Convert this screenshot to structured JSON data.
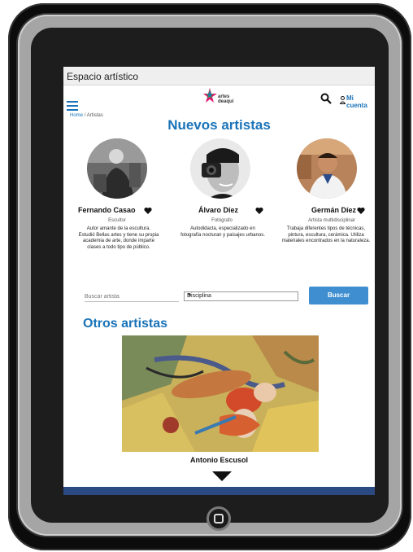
{
  "window": {
    "title": "Espacio artístico"
  },
  "header": {
    "logo_text": "artes deaquí",
    "account_label": "Mi cuenta"
  },
  "breadcrumb": {
    "home": "Home",
    "separator": "/",
    "current": "Artistas"
  },
  "page_title": "Nuevos artistas",
  "artists": [
    {
      "name": "Fernando Casao",
      "role": "Escultor",
      "description": "Autor amante de la escultura. Estudió Bellas artes y tiene su propia academia de arte, donde imparte clases a todo tipo de público."
    },
    {
      "name": "Álvaro Díez",
      "role": "Fotógrafo",
      "description": "Autodidacta, especializado en fotografía nocturan y paisajes urbanos."
    },
    {
      "name": "Germán Díez",
      "role": "Artista multidisciplinar",
      "description": "Trabaja diferentes tipos de técnicas, pintura, escultura, cerámica. Utiliza materiales encontrados en la naturaleza."
    }
  ],
  "search": {
    "placeholder": "Buscar artista",
    "discipline_selected": "Disciplina",
    "button_label": "Buscar"
  },
  "other_section": {
    "title": "Otros artistas",
    "featured_name": "Antonio Escusol"
  },
  "colors": {
    "accent": "#1a73b8",
    "button": "#3e8ed0",
    "footer": "#2c4a82"
  },
  "icons": [
    "hamburger-icon",
    "search-icon",
    "account-icon",
    "heart-icon",
    "chevron-down-icon",
    "down-arrow-icon"
  ]
}
